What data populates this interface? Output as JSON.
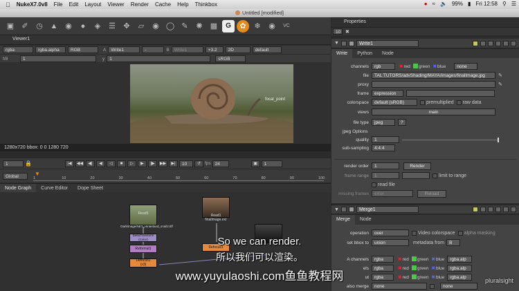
{
  "menubar": {
    "app_name": "NukeX7.0v8",
    "items": [
      "File",
      "Edit",
      "Layout",
      "Viewer",
      "Render",
      "Cache",
      "Help",
      "Thinkbox"
    ],
    "battery": "99%",
    "time": "Fri 12:58"
  },
  "window": {
    "title": "Untitled [modified]"
  },
  "viewer": {
    "tab_label": "Viewer1",
    "channels": "rgba",
    "channel_display": "rgba.alpha",
    "color": "RGB",
    "input_a_label": "A",
    "input_a": "Write1",
    "input_mid": "-",
    "input_b_label": "B",
    "input_b": "Write1",
    "gain": "+3.2",
    "view_mode": "2D",
    "proxy_mode": "default",
    "fstop": "f/8",
    "frame_field": "1",
    "y_label": "y",
    "y_value": "1",
    "lut": "sRGB",
    "image_label": "focal_point",
    "status": "1280x720 bbox: 0 0 1280 720"
  },
  "playback": {
    "start_frame": "1",
    "step": "10",
    "fps_label": "fps",
    "fps": "24",
    "end_frame": "1",
    "range_mode": "Global",
    "ticks": [
      "1",
      "10",
      "20",
      "30",
      "40",
      "50",
      "60",
      "70",
      "80",
      "90",
      "100"
    ]
  },
  "node_graph": {
    "tabs": [
      "Node Graph",
      "Curve Editor",
      "Dope Sheet"
    ],
    "nodes": [
      {
        "label": "Read5",
        "sub": "DarkImage/NET_Hinterland_snail2.tiff"
      },
      {
        "label": "Read1",
        "sub": "finalImage.exr"
      },
      {
        "label": "DeltaTransform",
        "sub": "(Color)"
      },
      {
        "label": "Reformat1",
        "sub": ""
      },
      {
        "label": "Defocus1",
        "sub": "(x3)"
      },
      {
        "label": "Defocus1",
        "sub": ""
      }
    ]
  },
  "properties": {
    "title": "Properties",
    "node_count": "10",
    "write": {
      "name": "Write1",
      "tabs": [
        "Write",
        "Python",
        "Node"
      ],
      "channels_label": "channels",
      "channels_value": "rgb",
      "channel_red": "red",
      "channel_green": "green",
      "channel_blue": "blue",
      "channel_extra": "none",
      "file_label": "file",
      "file_value": "TAL TUTORS/advShading/MAYA/images/finalImage.jpg",
      "proxy_label": "proxy",
      "frame_label": "frame",
      "frame_value": "expression",
      "colorspace_label": "colorspace",
      "colorspace_value": "default (sRGB)",
      "premultiplied_label": "premultiplied",
      "raw_data_label": "raw data",
      "views_label": "views",
      "views_value": "main",
      "file_type_label": "file type",
      "file_type_value": "jpeg",
      "help_mark": "?",
      "jpeg_options_label": "jpeg Options",
      "quality_label": "quality",
      "quality_value": "1",
      "subsampling_label": "sub-sampling",
      "subsampling_value": "4:4:4",
      "render_order_label": "render order",
      "render_order_value": "1",
      "render_button": "Render",
      "frame_range_label": "frame range",
      "frame_range_value": "1",
      "limit_to_range_label": "limit to range",
      "read_file_label": "read file",
      "missing_frames_label": "missing frames",
      "missing_frames_value": "error",
      "reload_button": "Reload"
    },
    "merge": {
      "name": "Merge1",
      "tabs": [
        "Merge",
        "Node"
      ],
      "operation_label": "operation",
      "operation_value": "over",
      "video_colorspace_label": "Video colorspace",
      "alpha_masking_label": "alpha masking",
      "set_bbox_label": "set bbox to",
      "set_bbox_value": "union",
      "metadata_from_label": "metadata from",
      "metadata_from_value": "B",
      "a_channels_label": "A channels",
      "b_channels_label": "els",
      "output_label": "ut",
      "channel_value": "rgba",
      "channel_red": "red",
      "channel_green": "green",
      "channel_blue": "blue",
      "channel_alpha_out": "rgba.alp",
      "also_merge_label": "also merge",
      "also_merge_value": "none"
    }
  },
  "subtitles": {
    "en": "So we can render.",
    "zh": "所以我们可以渲染。",
    "watermark": "www.yuyulaoshi.com鱼鱼教程网"
  },
  "branding": {
    "pluralsight": "pluralsight"
  }
}
